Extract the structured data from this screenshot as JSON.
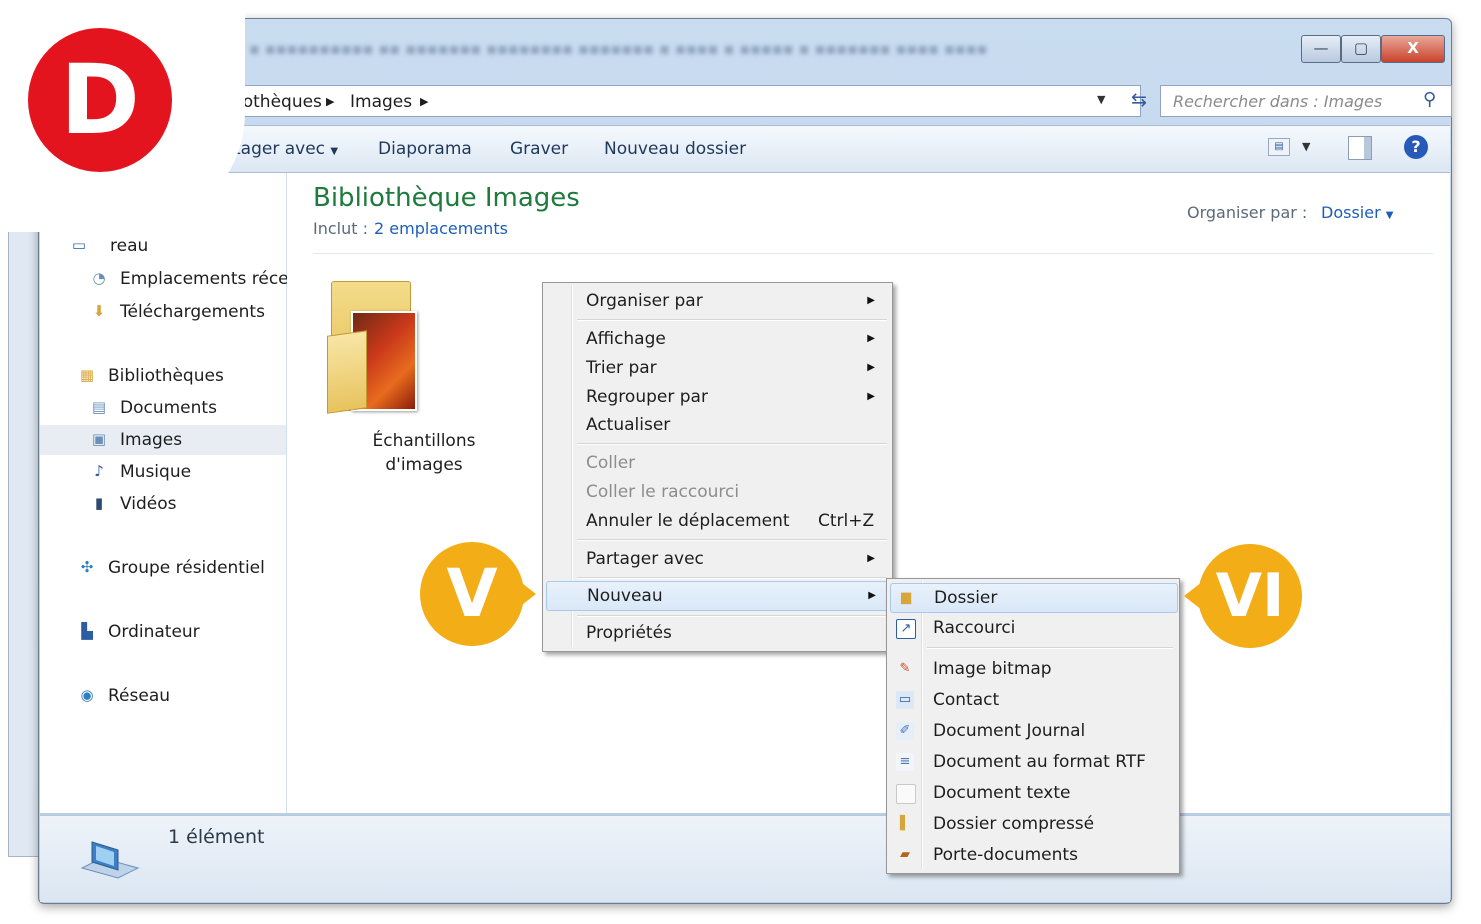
{
  "window": {
    "breadcrumb": [
      "iothèques",
      "Images"
    ],
    "search_placeholder": "Rechercher dans : Images",
    "close_glyph": "X"
  },
  "toolbar": {
    "share_label": "tager avec",
    "slideshow_label": "Diaporama",
    "burn_label": "Graver",
    "new_folder_label": "Nouveau dossier"
  },
  "nav": {
    "items": [
      {
        "label": "reau",
        "icon": "desktop-icon"
      },
      {
        "label": "Emplacements récen",
        "icon": "recent-places-icon"
      },
      {
        "label": "Téléchargements",
        "icon": "downloads-icon"
      },
      {
        "label": "Bibliothèques",
        "icon": "libraries-icon"
      },
      {
        "label": "Documents",
        "icon": "documents-icon"
      },
      {
        "label": "Images",
        "icon": "pictures-icon"
      },
      {
        "label": "Musique",
        "icon": "music-icon"
      },
      {
        "label": "Vidéos",
        "icon": "videos-icon"
      },
      {
        "label": "Groupe résidentiel",
        "icon": "homegroup-icon"
      },
      {
        "label": "Ordinateur",
        "icon": "computer-icon"
      },
      {
        "label": "Réseau",
        "icon": "network-icon"
      }
    ]
  },
  "content": {
    "title": "Bibliothèque Images",
    "includes_label": "Inclut :",
    "includes_link": "2 emplacements",
    "organize_label": "Organiser par :",
    "organize_value": "Dossier",
    "folder_name_line1": "Échantillons",
    "folder_name_line2": "d'images"
  },
  "status": {
    "count": "1 élément"
  },
  "context_menu": {
    "items": [
      {
        "label": "Organiser par"
      },
      {
        "label": "Affichage"
      },
      {
        "label": "Trier par"
      },
      {
        "label": "Regrouper par"
      },
      {
        "label": "Actualiser"
      },
      {
        "label": "Coller"
      },
      {
        "label": "Coller le raccourci"
      },
      {
        "label": "Annuler le déplacement",
        "shortcut": "Ctrl+Z"
      },
      {
        "label": "Partager avec"
      },
      {
        "label": "Nouveau"
      },
      {
        "label": "Propriétés"
      }
    ]
  },
  "submenu_new": {
    "items": [
      {
        "label": "Dossier",
        "icon": "folder-icon"
      },
      {
        "label": "Raccourci",
        "icon": "shortcut-icon"
      },
      {
        "label": "Image bitmap",
        "icon": "bitmap-icon"
      },
      {
        "label": "Contact",
        "icon": "contact-icon"
      },
      {
        "label": "Document Journal",
        "icon": "journal-icon"
      },
      {
        "label": "Document au format RTF",
        "icon": "rtf-icon"
      },
      {
        "label": "Document texte",
        "icon": "text-document-icon"
      },
      {
        "label": "Dossier compressé",
        "icon": "zip-folder-icon"
      },
      {
        "label": "Porte-documents",
        "icon": "briefcase-icon"
      }
    ]
  },
  "badges": {
    "d": "D",
    "v": "V",
    "vi": "VI"
  },
  "colors": {
    "accent_green": "#1f7a3e",
    "link_blue": "#1c5fb8",
    "badge_red": "#e3141d",
    "badge_yellow": "#f3ad16"
  }
}
